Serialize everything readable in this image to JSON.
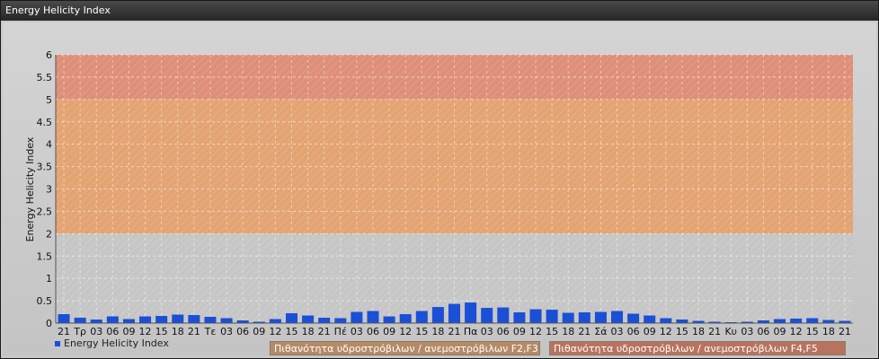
{
  "window": {
    "title": "Energy Helicity Index"
  },
  "zones": {
    "f2f3_label": "Πιθανότητα υδροστρόβιλων / ανεμοστρόβιλων F2,F3",
    "f4f5_label": "Πιθανότητα υδροστρόβιλων / ανεμοστρόβιλων F4,F5"
  },
  "legend": {
    "series_label": "Energy Helicity Index"
  },
  "colors": {
    "bar": "#1a4fd6",
    "zone_high": "#e08a72",
    "zone_mid": "#e6a06a",
    "zone_low": "#dca27e",
    "plot_bg": "#c6c6c6"
  },
  "chart_data": {
    "type": "bar",
    "ylabel": "Energy Helicity Index",
    "xlabel": "",
    "ylim": [
      0,
      6
    ],
    "yticks": [
      "0",
      "0.5",
      "1",
      "1.5",
      "2",
      "2.5",
      "3",
      "3.5",
      "4",
      "4.5",
      "5",
      "5.5",
      "6"
    ],
    "bands": [
      {
        "from": 2,
        "to": 5,
        "color": "#e6a06a"
      },
      {
        "from": 5,
        "to": 6,
        "color": "#e08a72"
      }
    ],
    "grid": true,
    "legend_position": "bottom-left",
    "categories": [
      "21",
      "Τρ",
      "03",
      "06",
      "09",
      "12",
      "15",
      "18",
      "21",
      "Τε",
      "03",
      "06",
      "09",
      "12",
      "15",
      "18",
      "21",
      "Πέ",
      "03",
      "06",
      "09",
      "12",
      "15",
      "18",
      "21",
      "Πα",
      "03",
      "06",
      "09",
      "12",
      "15",
      "18",
      "21",
      "Σά",
      "03",
      "06",
      "09",
      "12",
      "15",
      "18",
      "21",
      "Κυ",
      "03",
      "06",
      "09",
      "12",
      "15",
      "18",
      "21"
    ],
    "series": [
      {
        "name": "Energy Helicity Index",
        "values": [
          0.2,
          0.12,
          0.08,
          0.15,
          0.09,
          0.15,
          0.16,
          0.19,
          0.18,
          0.14,
          0.11,
          0.06,
          0.03,
          0.09,
          0.22,
          0.17,
          0.12,
          0.11,
          0.25,
          0.27,
          0.15,
          0.2,
          0.27,
          0.36,
          0.43,
          0.46,
          0.34,
          0.35,
          0.24,
          0.31,
          0.3,
          0.23,
          0.24,
          0.25,
          0.27,
          0.21,
          0.17,
          0.11,
          0.08,
          0.05,
          0.03,
          0.02,
          0.03,
          0.06,
          0.09,
          0.1,
          0.11,
          0.07,
          0.05
        ]
      }
    ]
  }
}
